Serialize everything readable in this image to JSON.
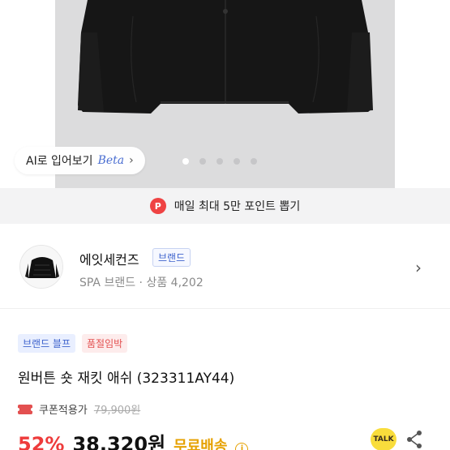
{
  "hero": {
    "ai_label": "AI로 입어보기",
    "beta_label": "Beta",
    "dots_count": 5,
    "active_dot": 0
  },
  "points_banner": {
    "badge": "P",
    "text": "매일 최대 5만 포인트 뽑기"
  },
  "brand": {
    "name": "에잇세컨즈",
    "tag": "브랜드",
    "subtitle": "SPA 브랜드 · 상품 4,202"
  },
  "product": {
    "tags": [
      {
        "label": "브랜드 블프",
        "style": "blue"
      },
      {
        "label": "품절임박",
        "style": "red"
      }
    ],
    "title": "원버튼 숏 재킷  애쉬 (323311AY44)",
    "coupon_label": "쿠폰적용가",
    "original_price": "79,900원",
    "discount": "52%",
    "price": "38,320원",
    "shipping": "무료배송"
  },
  "actions": {
    "talk_label": "TALK"
  },
  "colors": {
    "discount": "#ee3b3b",
    "shipping": "#e6a100",
    "brand_tag": "#3e63cc",
    "talk_bg": "#f9dd3c"
  }
}
